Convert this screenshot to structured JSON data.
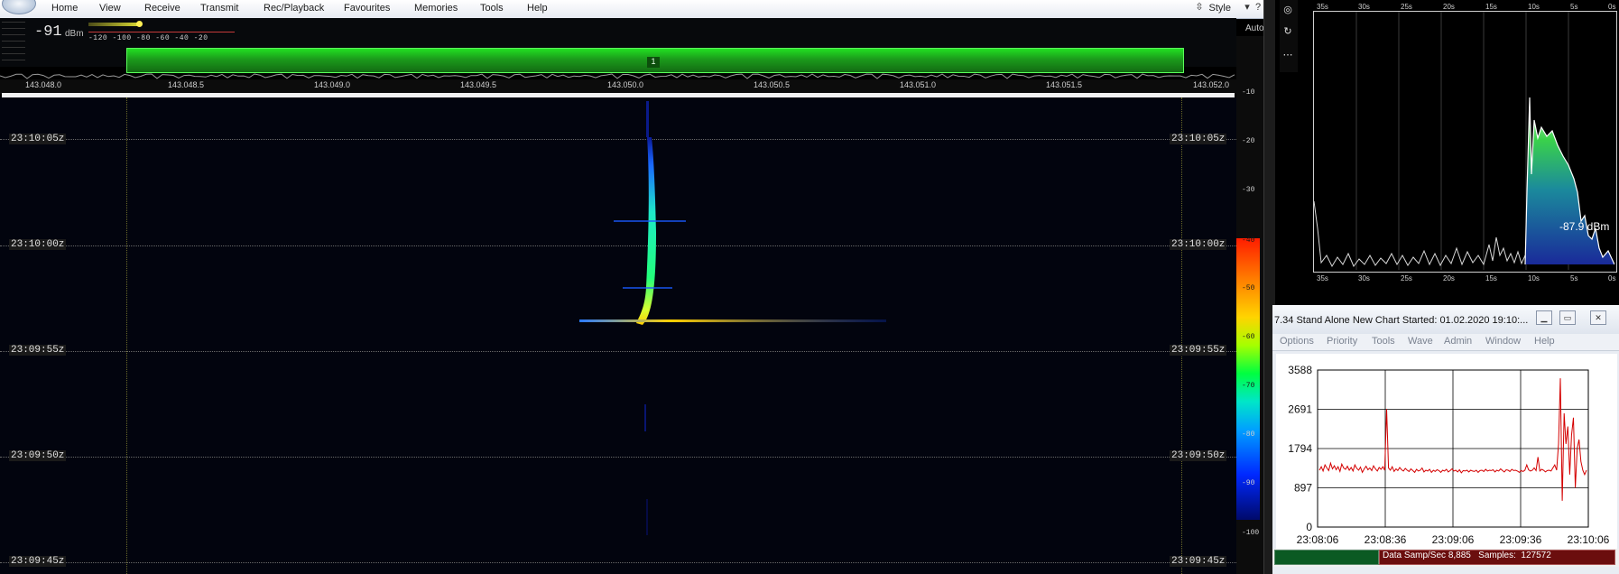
{
  "sdr": {
    "menu": [
      "Home",
      "View",
      "Receive",
      "Transmit",
      "Rec/Playback",
      "Favourites",
      "Memories",
      "Tools",
      "Help"
    ],
    "style_label": "Style",
    "signal": {
      "value": "-91",
      "unit": "dBm",
      "scale_ticks": "-120 -100 -80 -60 -40 -20"
    },
    "auto_label": "Auto",
    "band_label": "1",
    "freq_ticks": [
      "143.048.0",
      "143.048.5",
      "143.049.0",
      "143.049.5",
      "143.050.0",
      "143.050.5",
      "143.051.0",
      "143.051.5",
      "143.052.0"
    ],
    "timestamps": [
      "23:10:05z",
      "23:10:00z",
      "23:09:55z",
      "23:09:50z",
      "23:09:45z"
    ],
    "level_scale": [
      "-10",
      "-20",
      "-30",
      "-40",
      "-50",
      "-60",
      "-70",
      "-80",
      "-90",
      "-100"
    ],
    "colors": {
      "band": "#22d022",
      "waterfall_bg": "#02040e"
    }
  },
  "history": {
    "top_ticks": [
      "35s",
      "30s",
      "25s",
      "20s",
      "15s",
      "10s",
      "5s",
      "0s"
    ],
    "bottom_ticks": [
      "35s",
      "30s",
      "25s",
      "20s",
      "15s",
      "10s",
      "5s",
      "0s"
    ],
    "readout": "-87.9 dBm",
    "controls": [
      "target-icon",
      "refresh-icon",
      "more-icon"
    ]
  },
  "chart_app": {
    "title": "7.34   Stand Alone   New Chart Started: 01.02.2020 19:10:...",
    "menu": [
      "Options",
      "Priority",
      "Tools",
      "Wave",
      "Admin",
      "Window",
      "Help"
    ],
    "status_text": "Data Samp/Sec 8,885   Samples:  127572"
  },
  "chart_data": {
    "type": "line",
    "ylim": [
      0,
      3588
    ],
    "yticks": [
      "3588",
      "2691",
      "1794",
      "897",
      "0"
    ],
    "xticks": [
      "23:08:06",
      "23:08:36",
      "23:09:06",
      "23:09:36",
      "23:10:06"
    ],
    "series": [
      {
        "color": "#d40000",
        "values": [
          1300,
          1380,
          1280,
          1420,
          1350,
          1290,
          1460,
          1330,
          1400,
          1310,
          1380,
          1270,
          1440,
          1350,
          1320,
          1390,
          1300,
          1360,
          1280,
          1420,
          1340,
          1300,
          1370,
          1250,
          1330,
          1390,
          1310,
          1350,
          1290,
          1400,
          1330,
          1280,
          1360,
          1320,
          1380,
          1300,
          2700,
          1350,
          1300,
          1380,
          1270,
          1330,
          1290,
          1360,
          1310,
          1280,
          1340,
          1300,
          1270,
          1330,
          1290,
          1250,
          1320,
          1280,
          1300,
          1350,
          1260,
          1300,
          1280,
          1320,
          1250,
          1300,
          1270,
          1310,
          1290,
          1250,
          1300,
          1280,
          1320,
          1260,
          1290,
          1330,
          1280,
          1300,
          1260,
          1310,
          1240,
          1290,
          1280,
          1300,
          1260,
          1300,
          1280,
          1270,
          1300,
          1250,
          1290,
          1300,
          1270,
          1320,
          1280,
          1300,
          1290,
          1310,
          1260,
          1300,
          1280,
          1330,
          1290,
          1260,
          1310,
          1300,
          1270,
          1320,
          1290,
          1300,
          1280,
          1250,
          1290,
          1270,
          1300,
          1420,
          1310,
          1280,
          1300,
          1350,
          1290,
          1600,
          1280,
          1320,
          1300,
          1260,
          1290,
          1300,
          1280,
          1350,
          1420,
          1300,
          1900,
          3400,
          600,
          2600,
          1900,
          2300,
          1200,
          2100,
          2500,
          900,
          1800,
          2000,
          1500,
          1300,
          1200,
          1300
        ]
      }
    ]
  }
}
